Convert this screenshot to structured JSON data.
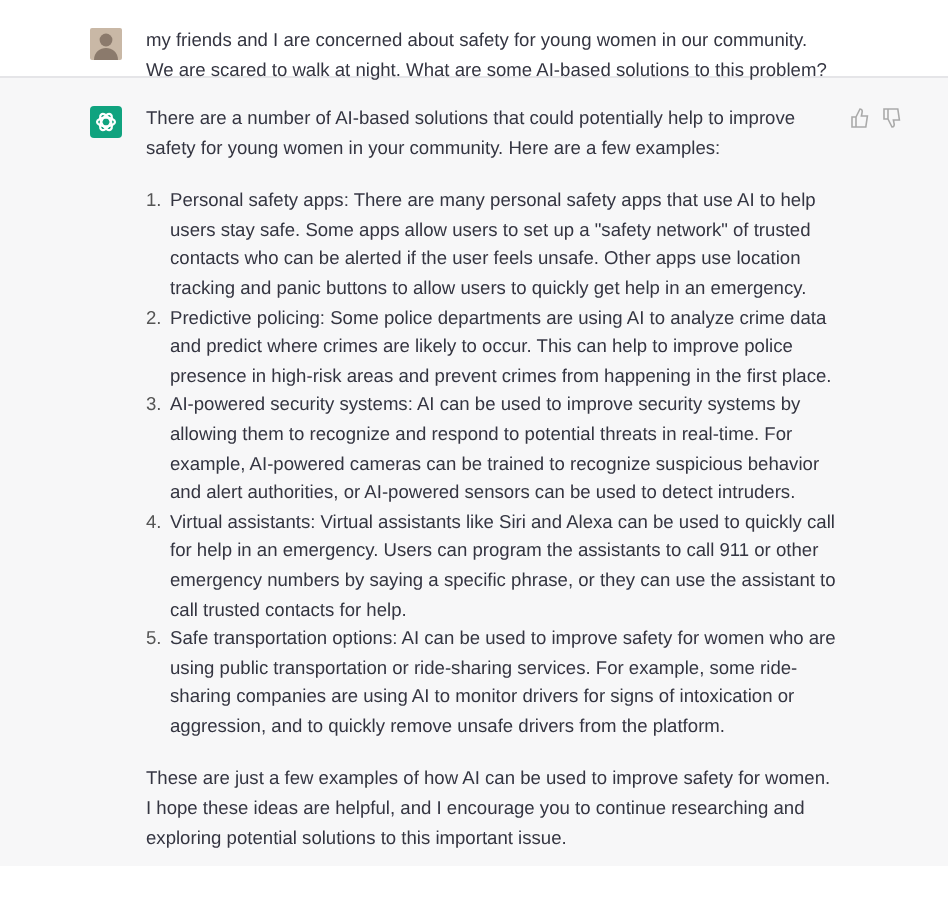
{
  "user_message": {
    "text": "my friends and I are concerned about safety for young women in our community. We are scared to walk at night. What are some AI-based solutions to this problem?"
  },
  "assistant_message": {
    "intro": "There are a number of AI-based solutions that could potentially help to improve safety for young women in your community. Here are a few examples:",
    "items": [
      {
        "number": "1.",
        "text": "Personal safety apps: There are many personal safety apps that use AI to help users stay safe. Some apps allow users to set up a \"safety network\" of trusted contacts who can be alerted if the user feels unsafe. Other apps use location tracking and panic buttons to allow users to quickly get help in an emergency."
      },
      {
        "number": "2.",
        "text": "Predictive policing: Some police departments are using AI to analyze crime data and predict where crimes are likely to occur. This can help to improve police presence in high-risk areas and prevent crimes from happening in the first place."
      },
      {
        "number": "3.",
        "text": "AI-powered security systems: AI can be used to improve security systems by allowing them to recognize and respond to potential threats in real-time. For example, AI-powered cameras can be trained to recognize suspicious behavior and alert authorities, or AI-powered sensors can be used to detect intruders."
      },
      {
        "number": "4.",
        "text": "Virtual assistants: Virtual assistants like Siri and Alexa can be used to quickly call for help in an emergency. Users can program the assistants to call 911 or other emergency numbers by saying a specific phrase, or they can use the assistant to call trusted contacts for help."
      },
      {
        "number": "5.",
        "text": "Safe transportation options: AI can be used to improve safety for women who are using public transportation or ride-sharing services. For example, some ride-sharing companies are using AI to monitor drivers for signs of intoxication or aggression, and to quickly remove unsafe drivers from the platform."
      }
    ],
    "outro": "These are just a few examples of how AI can be used to improve safety for women. I hope these ideas are helpful, and I encourage you to continue researching and exploring potential solutions to this important issue."
  }
}
